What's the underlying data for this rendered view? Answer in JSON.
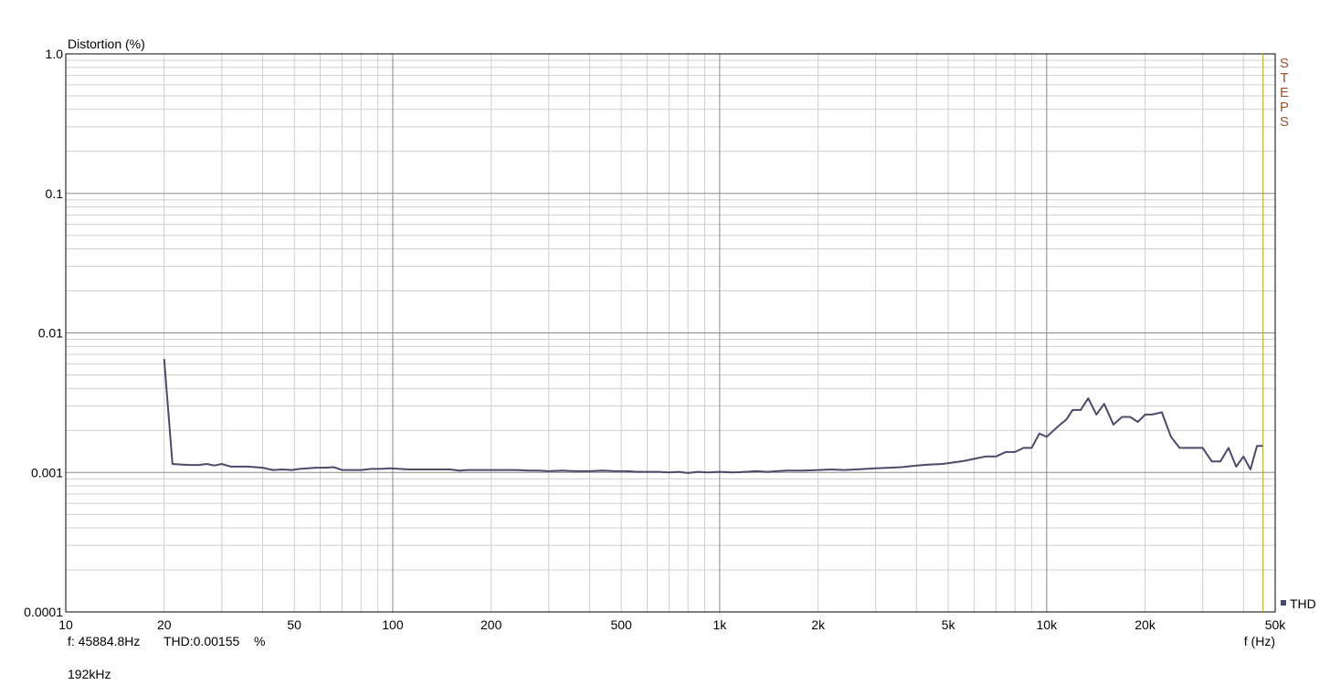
{
  "chart_data": {
    "type": "line",
    "title": "",
    "ylabel": "Distortion (%)",
    "xlabel": "f (Hz)",
    "x_scale": "log",
    "y_scale": "log",
    "xlim": [
      10,
      50000
    ],
    "ylim": [
      0.0001,
      1.0
    ],
    "grid": true,
    "legend_position": "bottom-right",
    "x_ticks": [
      {
        "v": 10,
        "label": "10"
      },
      {
        "v": 20,
        "label": "20"
      },
      {
        "v": 50,
        "label": "50"
      },
      {
        "v": 100,
        "label": "100"
      },
      {
        "v": 200,
        "label": "200"
      },
      {
        "v": 500,
        "label": "500"
      },
      {
        "v": 1000,
        "label": "1k"
      },
      {
        "v": 2000,
        "label": "2k"
      },
      {
        "v": 5000,
        "label": "5k"
      },
      {
        "v": 10000,
        "label": "10k"
      },
      {
        "v": 20000,
        "label": "20k"
      },
      {
        "v": 50000,
        "label": "50k"
      }
    ],
    "y_ticks": [
      {
        "v": 1.0,
        "label": "1.0"
      },
      {
        "v": 0.1,
        "label": "0.1"
      },
      {
        "v": 0.01,
        "label": "0.01"
      },
      {
        "v": 0.001,
        "label": "0.001"
      },
      {
        "v": 0.0001,
        "label": "0.0001"
      }
    ],
    "marker_line": {
      "x": 45884.8,
      "label": "STEPS",
      "color": "#c8b400"
    },
    "series": [
      {
        "name": "THD",
        "color": "#4a4a6a",
        "x": [
          20,
          21.2,
          22.5,
          24,
          25.5,
          27,
          28.5,
          30,
          32,
          34,
          36,
          38,
          40,
          43,
          46,
          49,
          52,
          55,
          58,
          62,
          66,
          70,
          75,
          80,
          86,
          92,
          98,
          105,
          112,
          120,
          130,
          140,
          150,
          160,
          170,
          180,
          200,
          220,
          240,
          260,
          280,
          300,
          330,
          360,
          400,
          440,
          480,
          520,
          560,
          600,
          650,
          700,
          750,
          800,
          860,
          920,
          1000,
          1100,
          1200,
          1300,
          1400,
          1500,
          1600,
          1800,
          2000,
          2200,
          2400,
          2600,
          2800,
          3000,
          3300,
          3600,
          4000,
          4400,
          4800,
          5200,
          5600,
          6000,
          6500,
          7000,
          7500,
          8000,
          8500,
          9000,
          9500,
          10000,
          10500,
          11000,
          11500,
          12000,
          12700,
          13400,
          14200,
          15000,
          16000,
          17000,
          18000,
          19000,
          20000,
          21000,
          22500,
          24000,
          25500,
          27000,
          28500,
          30000,
          32000,
          34000,
          36000,
          38000,
          40000,
          42000,
          44000,
          45885
        ],
        "values": [
          0.0065,
          0.00115,
          0.00114,
          0.00113,
          0.00113,
          0.00115,
          0.00112,
          0.00115,
          0.0011,
          0.0011,
          0.0011,
          0.00109,
          0.00108,
          0.00104,
          0.00105,
          0.00104,
          0.00106,
          0.00107,
          0.00108,
          0.00108,
          0.00109,
          0.00104,
          0.00104,
          0.00104,
          0.00106,
          0.00106,
          0.00107,
          0.00106,
          0.00105,
          0.00105,
          0.00105,
          0.00105,
          0.00105,
          0.00103,
          0.00104,
          0.00104,
          0.00104,
          0.00104,
          0.00104,
          0.00103,
          0.00103,
          0.00102,
          0.00103,
          0.00102,
          0.00102,
          0.00103,
          0.00102,
          0.00102,
          0.00101,
          0.00101,
          0.00101,
          0.001,
          0.00101,
          0.00099,
          0.00101,
          0.001,
          0.00101,
          0.001,
          0.00101,
          0.00102,
          0.00101,
          0.00102,
          0.00103,
          0.00103,
          0.00104,
          0.00105,
          0.00104,
          0.00105,
          0.00106,
          0.00107,
          0.00108,
          0.00109,
          0.00112,
          0.00114,
          0.00115,
          0.00118,
          0.00121,
          0.00125,
          0.0013,
          0.0013,
          0.0014,
          0.0014,
          0.0015,
          0.0015,
          0.0019,
          0.0018,
          0.002,
          0.0022,
          0.0024,
          0.0028,
          0.0028,
          0.0034,
          0.0026,
          0.0031,
          0.0022,
          0.0025,
          0.0025,
          0.0023,
          0.0026,
          0.0026,
          0.0027,
          0.0018,
          0.0015,
          0.0015,
          0.0015,
          0.0015,
          0.0012,
          0.0012,
          0.0015,
          0.0011,
          0.0013,
          0.00105,
          0.00155,
          0.00155
        ]
      }
    ]
  },
  "readout": {
    "freq": "f: 45884.8Hz",
    "thd": "THD:0.00155",
    "unit": "%",
    "sample_rate": "192kHz"
  },
  "legend": {
    "label": "THD",
    "color": "#4a4a6a"
  }
}
